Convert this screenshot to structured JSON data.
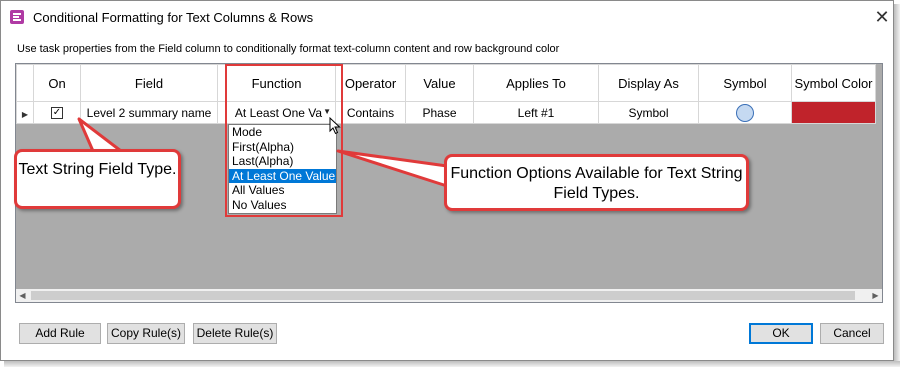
{
  "window": {
    "title": "Conditional Formatting for Text Columns & Rows",
    "close_glyph": "✕",
    "app_icon": "task-list-icon"
  },
  "description": "Use task properties from the Field column to conditionally format text-column content and row background color",
  "grid": {
    "columns": [
      "",
      "On",
      "Field",
      "Function",
      "Operator",
      "Value",
      "Applies To",
      "Display As",
      "Symbol",
      "Symbol Color"
    ],
    "rows": [
      {
        "on": true,
        "field": "Level 2 summary name",
        "function": "At Least One Va",
        "operator": "Contains",
        "value": "Phase",
        "applies_to": "Left #1",
        "display_as": "Symbol",
        "symbol": "circle",
        "symbol_color": "#c0232b"
      }
    ]
  },
  "function_dropdown": {
    "options": [
      "Mode",
      "First(Alpha)",
      "Last(Alpha)",
      "At Least One Value",
      "All Values",
      "No Values"
    ],
    "selected_index": 3
  },
  "callouts": {
    "field_type": "Text String Field Type.",
    "function_options": "Function Options Available for Text String Field Types."
  },
  "buttons": {
    "add_rule": "Add Rule",
    "copy_rules": "Copy Rule(s)",
    "delete_rules": "Delete Rule(s)",
    "ok": "OK",
    "cancel": "Cancel"
  },
  "colors": {
    "highlight": "#e03a3a",
    "selection": "#0078d7",
    "symbol_fill": "#c5d9f1",
    "symbol_color": "#c0232b"
  }
}
